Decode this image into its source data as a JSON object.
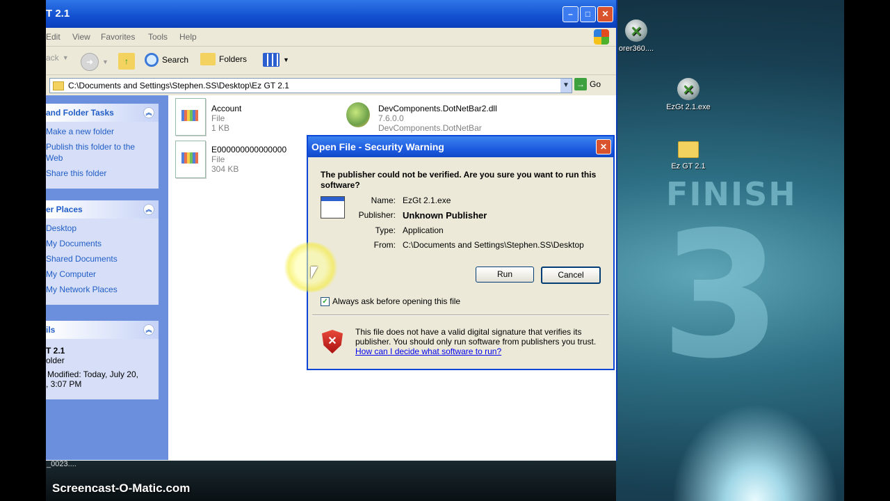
{
  "desktop": {
    "icons": [
      {
        "label": "orer360...."
      },
      {
        "label": "EzGt 2.1.exe"
      },
      {
        "label": "Ez GT 2.1"
      }
    ],
    "wallpaper_text": "FINISH",
    "wallpaper_number": "3",
    "bottom_label": "_0023....",
    "watermark": "Screencast-O-Matic.com"
  },
  "window": {
    "title": "T 2.1",
    "menu": [
      "Edit",
      "View",
      "Favorites",
      "Tools",
      "Help"
    ],
    "toolbar": {
      "back": "ack",
      "search": "Search",
      "folders": "Folders"
    },
    "address": {
      "path": "C:\\Documents and Settings\\Stephen.SS\\Desktop\\Ez GT 2.1",
      "go": "Go"
    },
    "tasks_panel": {
      "title": "and Folder Tasks",
      "links": [
        "Make a new folder",
        "Publish this folder to the",
        "Web",
        "Share this folder"
      ]
    },
    "places_panel": {
      "title": "er Places",
      "links": [
        "Desktop",
        "My Documents",
        "Shared Documents",
        "My Computer",
        "My Network Places"
      ]
    },
    "details_panel": {
      "title": "ils",
      "name": "T 2.1",
      "type": "older",
      "modified_line1": "Modified: Today, July 20,",
      "modified_line2": ", 3:07 PM"
    },
    "files": [
      {
        "name": "Account",
        "line2": "File",
        "line3": "1 KB"
      },
      {
        "name": "E000000000000000",
        "line2": "File",
        "line3": "304 KB"
      },
      {
        "name": "DevComponents.DotNetBar2.dll",
        "line2": "7.6.0.0",
        "line3": "DevComponents.DotNetBar"
      }
    ]
  },
  "dialog": {
    "title": "Open File - Security Warning",
    "question": "The publisher could not be verified.  Are you sure you want to run this software?",
    "fields": [
      {
        "key": "Name:",
        "value": "EzGt 2.1.exe"
      },
      {
        "key": "Publisher:",
        "value": "Unknown Publisher"
      },
      {
        "key": "Type:",
        "value": "Application"
      },
      {
        "key": "From:",
        "value": "C:\\Documents and Settings\\Stephen.SS\\Desktop"
      }
    ],
    "run_label": "Run",
    "cancel_label": "Cancel",
    "checkbox_label": "Always ask before opening this file",
    "checkbox_checked": true,
    "warning_text": "This file does not have a valid digital signature that verifies its publisher.  You should only run software from publishers you trust.",
    "help_link": "How can I decide what software to run?"
  }
}
